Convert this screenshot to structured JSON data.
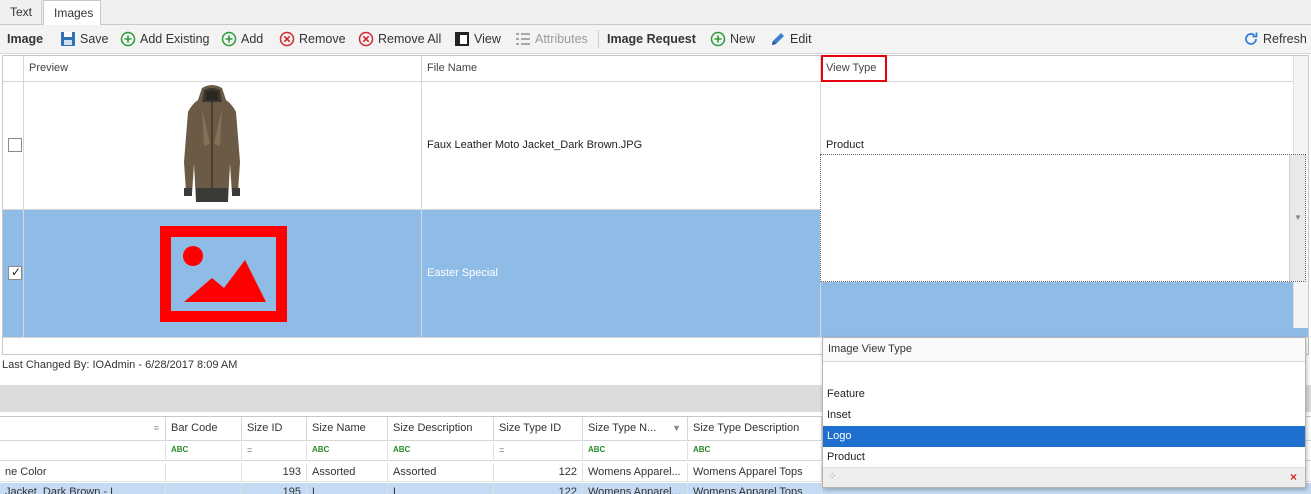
{
  "tabs": [
    {
      "label": "Text"
    },
    {
      "label": "Images"
    }
  ],
  "toolbar": {
    "image_label": "Image",
    "save": "Save",
    "add_existing": "Add Existing",
    "add": "Add",
    "remove": "Remove",
    "remove_all": "Remove All",
    "view": "View",
    "attributes": "Attributes",
    "image_request_label": "Image Request",
    "new": "New",
    "edit": "Edit",
    "refresh": "Refresh"
  },
  "images_grid": {
    "columns": [
      "Preview",
      "File Name",
      "View Type"
    ],
    "rows": [
      {
        "checked": false,
        "file_name": "Faux Leather Moto Jacket_Dark Brown.JPG",
        "view_type": "Product"
      },
      {
        "checked": true,
        "file_name": "Easter Special",
        "view_type": ""
      }
    ]
  },
  "status": {
    "last_changed": "Last Changed By: IOAdmin - 6/28/2017 8:09 AM"
  },
  "sizes_grid": {
    "columns": [
      "",
      "Bar Code",
      "Size ID",
      "Size Name",
      "Size Description",
      "Size Type ID",
      "Size Type N...",
      "Size Type Description"
    ],
    "rows": [
      [
        "ne Color",
        "",
        "193",
        "Assorted",
        "Assorted",
        "122",
        "Womens Apparel...",
        "Womens Apparel Tops"
      ],
      [
        "Jacket_Dark Brown - L",
        "",
        "195",
        "L",
        "L",
        "122",
        "Womens Apparel...",
        "Womens Apparel Tops"
      ]
    ]
  },
  "dropdown": {
    "header": "Image View Type",
    "items": [
      "",
      "Feature",
      "Inset",
      "Logo",
      "Product"
    ],
    "selected": "Logo"
  },
  "colors": {
    "accent": "#1e6fce",
    "selection": "#8fbbe7",
    "highlight": "#e3000f"
  }
}
